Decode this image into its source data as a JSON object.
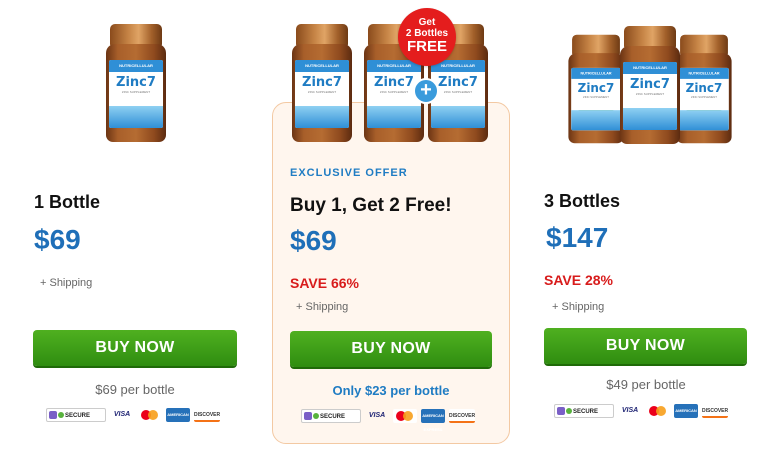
{
  "product": {
    "bottle_name": "Zinc7",
    "label_brand": "NUTRICELLULAR"
  },
  "packages": {
    "one": {
      "title": "1 Bottle",
      "price": "$69",
      "shipping": "+ Shipping",
      "button": "BUY NOW",
      "per_bottle": "$69 per bottle"
    },
    "two": {
      "badge_line1": "Get",
      "badge_line2": "2 Bottles",
      "badge_line3": "FREE",
      "plus": "+",
      "offer_tag": "EXCLUSIVE OFFER",
      "title": "Buy 1, Get 2 Free!",
      "price": "$69",
      "save": "SAVE 66%",
      "shipping": "+ Shipping",
      "button": "BUY NOW",
      "per_bottle": "Only $23 per bottle"
    },
    "three": {
      "title": "3 Bottles",
      "price": "$147",
      "save": "SAVE 28%",
      "shipping": "+ Shipping",
      "button": "BUY NOW",
      "per_bottle": "$49 per bottle"
    }
  },
  "payment_icons": {
    "secure": "SECURE",
    "visa": "VISA",
    "amex": "AMERICAN EXPRESS",
    "discover": "DISCOVER"
  },
  "colors": {
    "price_blue": "#1f6fb8",
    "save_red": "#d81b1b",
    "button_green": "#3a9e17",
    "highlight_bg": "#fff6ee",
    "badge_red": "#e41d1d"
  }
}
